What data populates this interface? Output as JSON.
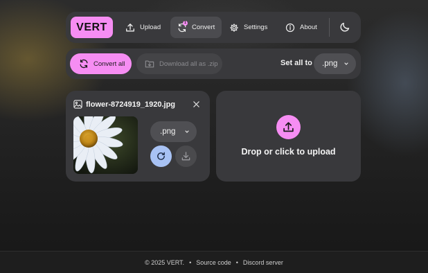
{
  "nav": {
    "logo": "VERT",
    "items": [
      {
        "label": "Upload",
        "icon": "upload-icon"
      },
      {
        "label": "Convert",
        "icon": "convert-icon",
        "active": true,
        "badge": "1"
      },
      {
        "label": "Settings",
        "icon": "gear-icon"
      },
      {
        "label": "About",
        "icon": "info-icon"
      }
    ],
    "theme_icon": "moon-icon"
  },
  "toolbar": {
    "convert_all_label": "Convert all",
    "download_all_label": "Download all as .zip",
    "set_all_label": "Set all to",
    "set_all_value": ".png"
  },
  "file": {
    "name": "flower-8724919_1920.jpg",
    "format": ".png"
  },
  "upload": {
    "label": "Drop or click to upload"
  },
  "footer": {
    "copyright": "© 2025 VERT.",
    "separator": "•",
    "source_code": "Source code",
    "discord": "Discord server"
  },
  "colors": {
    "accent": "#f68df3",
    "reconvert": "#a8c2f4",
    "panel": "#39393c"
  }
}
